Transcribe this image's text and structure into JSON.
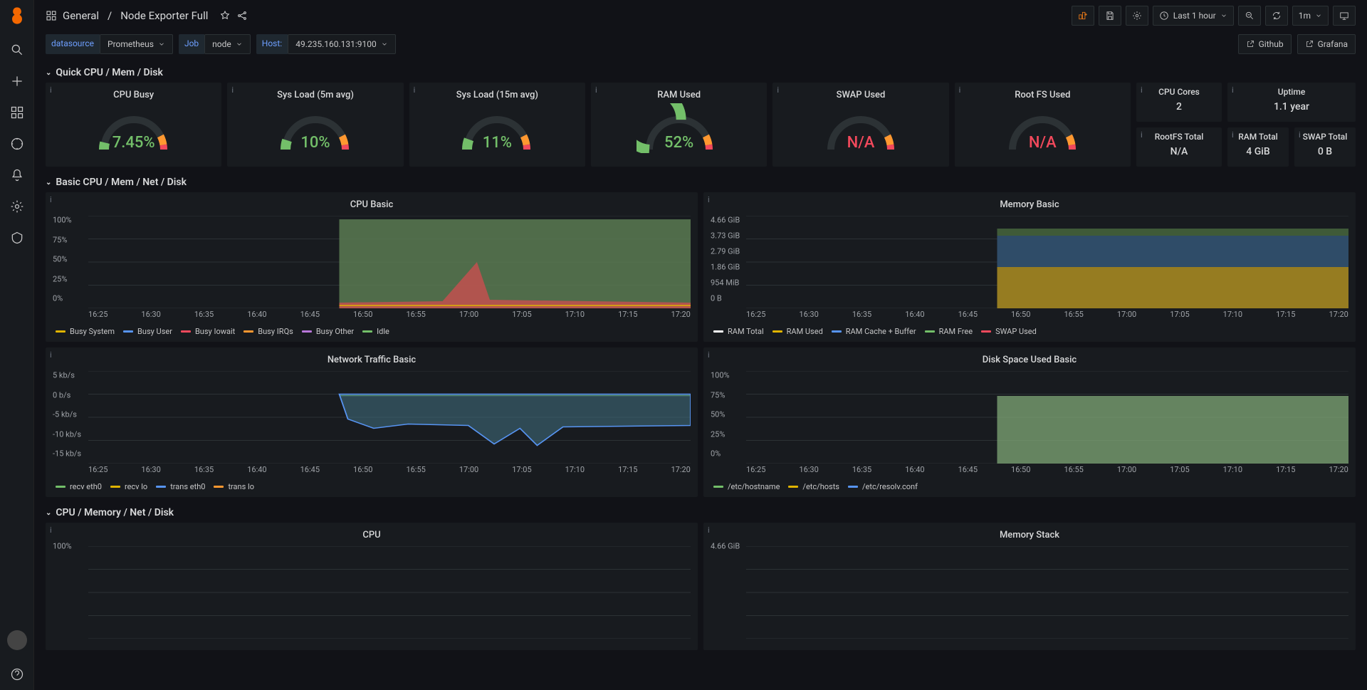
{
  "breadcrumb": {
    "folder": "General",
    "dash": "Node Exporter Full"
  },
  "toolbar": {
    "time_label": "Last 1 hour",
    "refresh_interval": "1m"
  },
  "templating": {
    "datasource_label": "datasource",
    "datasource_value": "Prometheus",
    "job_label": "Job",
    "job_value": "node",
    "host_label": "Host:",
    "host_value": "49.235.160.131:9100"
  },
  "links": {
    "github": "Github",
    "grafana": "Grafana"
  },
  "rows": {
    "quick": "Quick CPU / Mem / Disk",
    "basic": "Basic CPU / Mem / Net / Disk",
    "detail": "CPU / Memory / Net / Disk"
  },
  "gauges": [
    {
      "title": "CPU Busy",
      "value": "7.45%",
      "pct": 7.45,
      "color": "#73bf69"
    },
    {
      "title": "Sys Load (5m avg)",
      "value": "10%",
      "pct": 10,
      "color": "#73bf69"
    },
    {
      "title": "Sys Load (15m avg)",
      "value": "11%",
      "pct": 11,
      "color": "#73bf69"
    },
    {
      "title": "RAM Used",
      "value": "52%",
      "pct": 52,
      "color": "#73bf69"
    },
    {
      "title": "SWAP Used",
      "value": "N/A",
      "pct": 0,
      "color": "#f2495c"
    },
    {
      "title": "Root FS Used",
      "value": "N/A",
      "pct": 0,
      "color": "#f2495c"
    }
  ],
  "stats": {
    "cpu_cores_title": "CPU Cores",
    "cpu_cores_value": "2",
    "uptime_title": "Uptime",
    "uptime_value": "1.1 year",
    "rootfs_title": "RootFS Total",
    "rootfs_value": "N/A",
    "ramtotal_title": "RAM Total",
    "ramtotal_value": "4 GiB",
    "swaptotal_title": "SWAP Total",
    "swaptotal_value": "0 B"
  },
  "chart_data": [
    {
      "id": "cpu_basic",
      "title": "CPU Basic",
      "type": "area",
      "ylabel": "",
      "ylim": [
        0,
        100
      ],
      "yticks": [
        "100%",
        "75%",
        "50%",
        "25%",
        "0%"
      ],
      "xticks": [
        "16:25",
        "16:30",
        "16:35",
        "16:40",
        "16:45",
        "16:50",
        "16:55",
        "17:00",
        "17:05",
        "17:10",
        "17:15",
        "17:20"
      ],
      "series": [
        {
          "name": "Busy System",
          "color": "#e0b400"
        },
        {
          "name": "Busy User",
          "color": "#5794f2"
        },
        {
          "name": "Busy Iowait",
          "color": "#f2495c"
        },
        {
          "name": "Busy IRQs",
          "color": "#ff9830"
        },
        {
          "name": "Busy Other",
          "color": "#b877d9"
        },
        {
          "name": "Idle",
          "color": "#73bf69"
        }
      ],
      "data_note": "Idle ≈95%; small spike ~17:04 where busy reaches ~50%; data begins ~16:46"
    },
    {
      "id": "memory_basic",
      "title": "Memory Basic",
      "type": "area",
      "ylim": [
        0,
        4.66
      ],
      "yticks": [
        "4.66 GiB",
        "3.73 GiB",
        "2.79 GiB",
        "1.86 GiB",
        "954 MiB",
        "0 B"
      ],
      "xticks": [
        "16:25",
        "16:30",
        "16:35",
        "16:40",
        "16:45",
        "16:50",
        "16:55",
        "17:00",
        "17:05",
        "17:10",
        "17:15",
        "17:20"
      ],
      "series": [
        {
          "name": "RAM Total",
          "color": "#ffffff"
        },
        {
          "name": "RAM Used",
          "color": "#e0b400"
        },
        {
          "name": "RAM Cache + Buffer",
          "color": "#5794f2"
        },
        {
          "name": "RAM Free",
          "color": "#73bf69"
        },
        {
          "name": "SWAP Used",
          "color": "#f2495c"
        }
      ],
      "data_note": "Used ≈1.9GiB, Cache+Buffer to ≈3.6GiB, Total 4GiB flat; data begins ~16:46"
    },
    {
      "id": "network_basic",
      "title": "Network Traffic Basic",
      "type": "line",
      "ylim": [
        -15,
        5
      ],
      "yticks": [
        "5 kb/s",
        "0 b/s",
        "-5 kb/s",
        "-10 kb/s",
        "-15 kb/s"
      ],
      "xticks": [
        "16:25",
        "16:30",
        "16:35",
        "16:40",
        "16:45",
        "16:50",
        "16:55",
        "17:00",
        "17:05",
        "17:10",
        "17:15",
        "17:20"
      ],
      "series": [
        {
          "name": "recv eth0",
          "color": "#73bf69"
        },
        {
          "name": "recv lo",
          "color": "#e0b400"
        },
        {
          "name": "trans eth0",
          "color": "#5794f2"
        },
        {
          "name": "trans lo",
          "color": "#ff9830"
        }
      ],
      "data_note": "recv ~0, trans eth0 ≈ -6 to -12 kb/s with dips; data begins ~16:46"
    },
    {
      "id": "disk_basic",
      "title": "Disk Space Used Basic",
      "type": "area",
      "ylim": [
        0,
        100
      ],
      "yticks": [
        "100%",
        "75%",
        "50%",
        "25%",
        "0%"
      ],
      "xticks": [
        "16:25",
        "16:30",
        "16:35",
        "16:40",
        "16:45",
        "16:50",
        "16:55",
        "17:00",
        "17:05",
        "17:10",
        "17:15",
        "17:20"
      ],
      "series": [
        {
          "name": "/etc/hostname",
          "color": "#73bf69"
        },
        {
          "name": "/etc/hosts",
          "color": "#e0b400"
        },
        {
          "name": "/etc/resolv.conf",
          "color": "#5794f2"
        }
      ],
      "data_note": "Flat at ≈73% from ~16:46"
    },
    {
      "id": "cpu_detail",
      "title": "CPU",
      "type": "area",
      "yticks": [
        "100%"
      ],
      "xticks": [],
      "series": []
    },
    {
      "id": "memory_stack",
      "title": "Memory Stack",
      "type": "area",
      "yticks": [
        "4.66 GiB"
      ],
      "xticks": [],
      "series": []
    }
  ]
}
